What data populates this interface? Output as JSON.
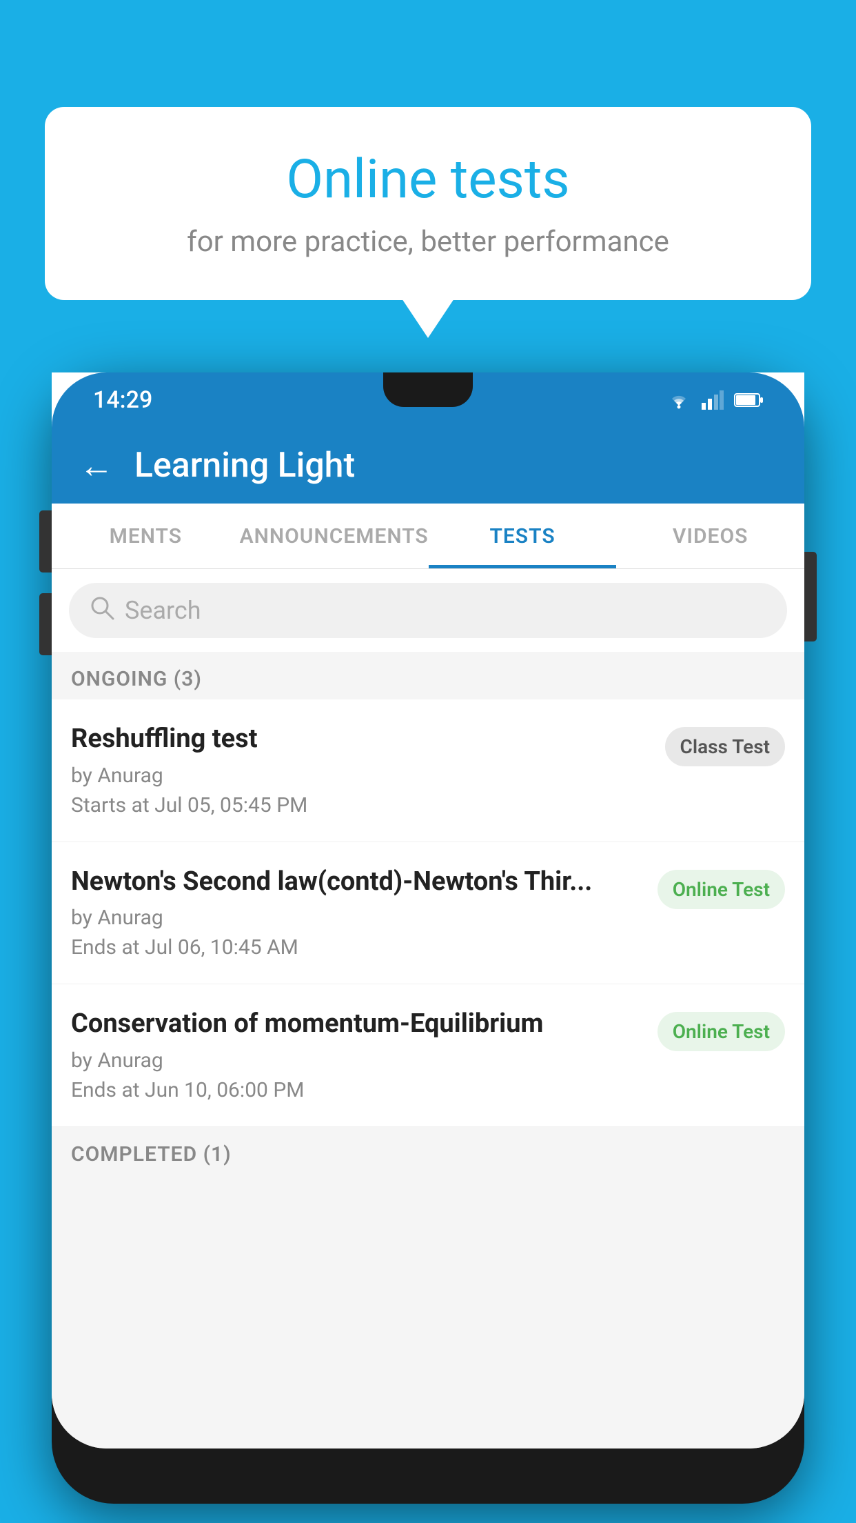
{
  "background_color": "#1AAFE6",
  "speech_bubble": {
    "title": "Online tests",
    "subtitle": "for more practice, better performance"
  },
  "phone": {
    "status_bar": {
      "time": "14:29",
      "wifi": true,
      "signal": true,
      "battery": true
    },
    "app_bar": {
      "back_label": "←",
      "title": "Learning Light"
    },
    "tabs": [
      {
        "label": "MENTS",
        "active": false
      },
      {
        "label": "ANNOUNCEMENTS",
        "active": false
      },
      {
        "label": "TESTS",
        "active": true
      },
      {
        "label": "VIDEOS",
        "active": false
      }
    ],
    "search": {
      "placeholder": "Search"
    },
    "ongoing_section": {
      "title": "ONGOING (3)",
      "items": [
        {
          "name": "Reshuffling test",
          "by": "by Anurag",
          "time": "Starts at  Jul 05, 05:45 PM",
          "badge": "Class Test",
          "badge_type": "class"
        },
        {
          "name": "Newton's Second law(contd)-Newton's Thir...",
          "by": "by Anurag",
          "time": "Ends at  Jul 06, 10:45 AM",
          "badge": "Online Test",
          "badge_type": "online"
        },
        {
          "name": "Conservation of momentum-Equilibrium",
          "by": "by Anurag",
          "time": "Ends at  Jun 10, 06:00 PM",
          "badge": "Online Test",
          "badge_type": "online"
        }
      ]
    },
    "completed_section": {
      "title": "COMPLETED (1)"
    }
  }
}
